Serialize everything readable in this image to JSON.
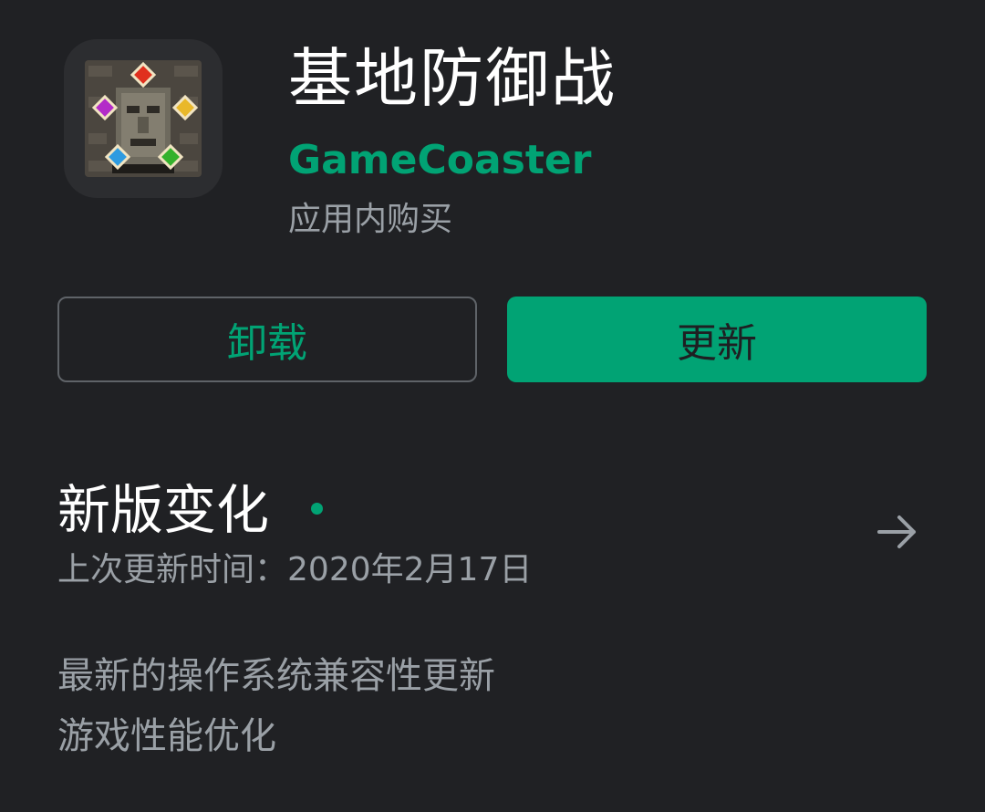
{
  "app": {
    "title": "基地防御战",
    "developer": "GameCoaster",
    "iap_note": "应用内购买",
    "icon": "pixel-art-stone-totem-app-icon"
  },
  "actions": {
    "uninstall_label": "卸载",
    "update_label": "更新"
  },
  "whats_new": {
    "title": "新版变化",
    "updated_label": "上次更新时间：",
    "updated_date": "2020年2月17日",
    "notes": [
      "最新的操作系统兼容性更新",
      "游戏性能优化"
    ]
  },
  "colors": {
    "background": "#202124",
    "accent": "#01a374",
    "secondary_text": "#9aa0a6",
    "border": "#5f6368"
  },
  "icons": {
    "arrow": "arrow-right-icon",
    "dot": "new-indicator-dot"
  }
}
